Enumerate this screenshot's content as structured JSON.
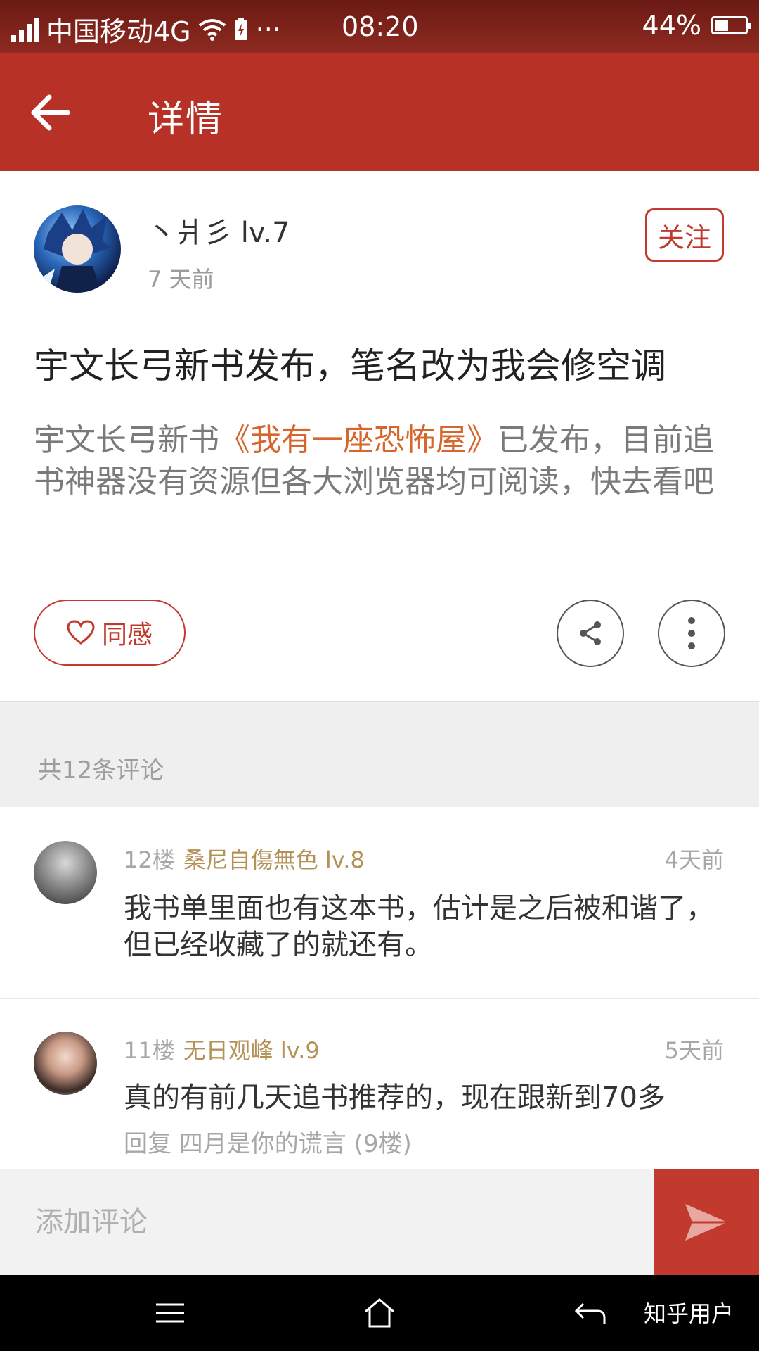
{
  "status_bar": {
    "carrier": "中国移动4G",
    "dots": "···",
    "time": "08:20",
    "battery": "44%",
    "battery_level": 0.44
  },
  "app_bar": {
    "title": "详情"
  },
  "post": {
    "username": "丶爿彡 lv.7",
    "time": "7 天前",
    "follow_label": "关注",
    "title": "宇文长弓新书发布，笔名改为我会修空调",
    "body_prefix": "宇文长弓新书",
    "book_title": "《我有一座恐怖屋》",
    "body_suffix": "已发布，目前追书神器没有资源但各大浏览器均可阅读，快去看吧",
    "like_label": "同感"
  },
  "comments_header": {
    "count_text": "共12条评论"
  },
  "comments": [
    {
      "floor": "12楼",
      "user": "桑尼自傷無色 lv.8",
      "time": "4天前",
      "text": "我书单里面也有这本书，估计是之后被和谐了，但已经收藏了的就还有。"
    },
    {
      "floor": "11楼",
      "user": "无日观峰 lv.9",
      "time": "5天前",
      "text": "真的有前几天追书推荐的，现在跟新到70多",
      "reply": "回复 四月是你的谎言 (9楼)"
    }
  ],
  "input_bar": {
    "placeholder": "添加评论"
  },
  "watermark": "知乎用户",
  "colors": {
    "accent": "#b73126",
    "book_link": "#d6662b",
    "username": "#b39257"
  }
}
